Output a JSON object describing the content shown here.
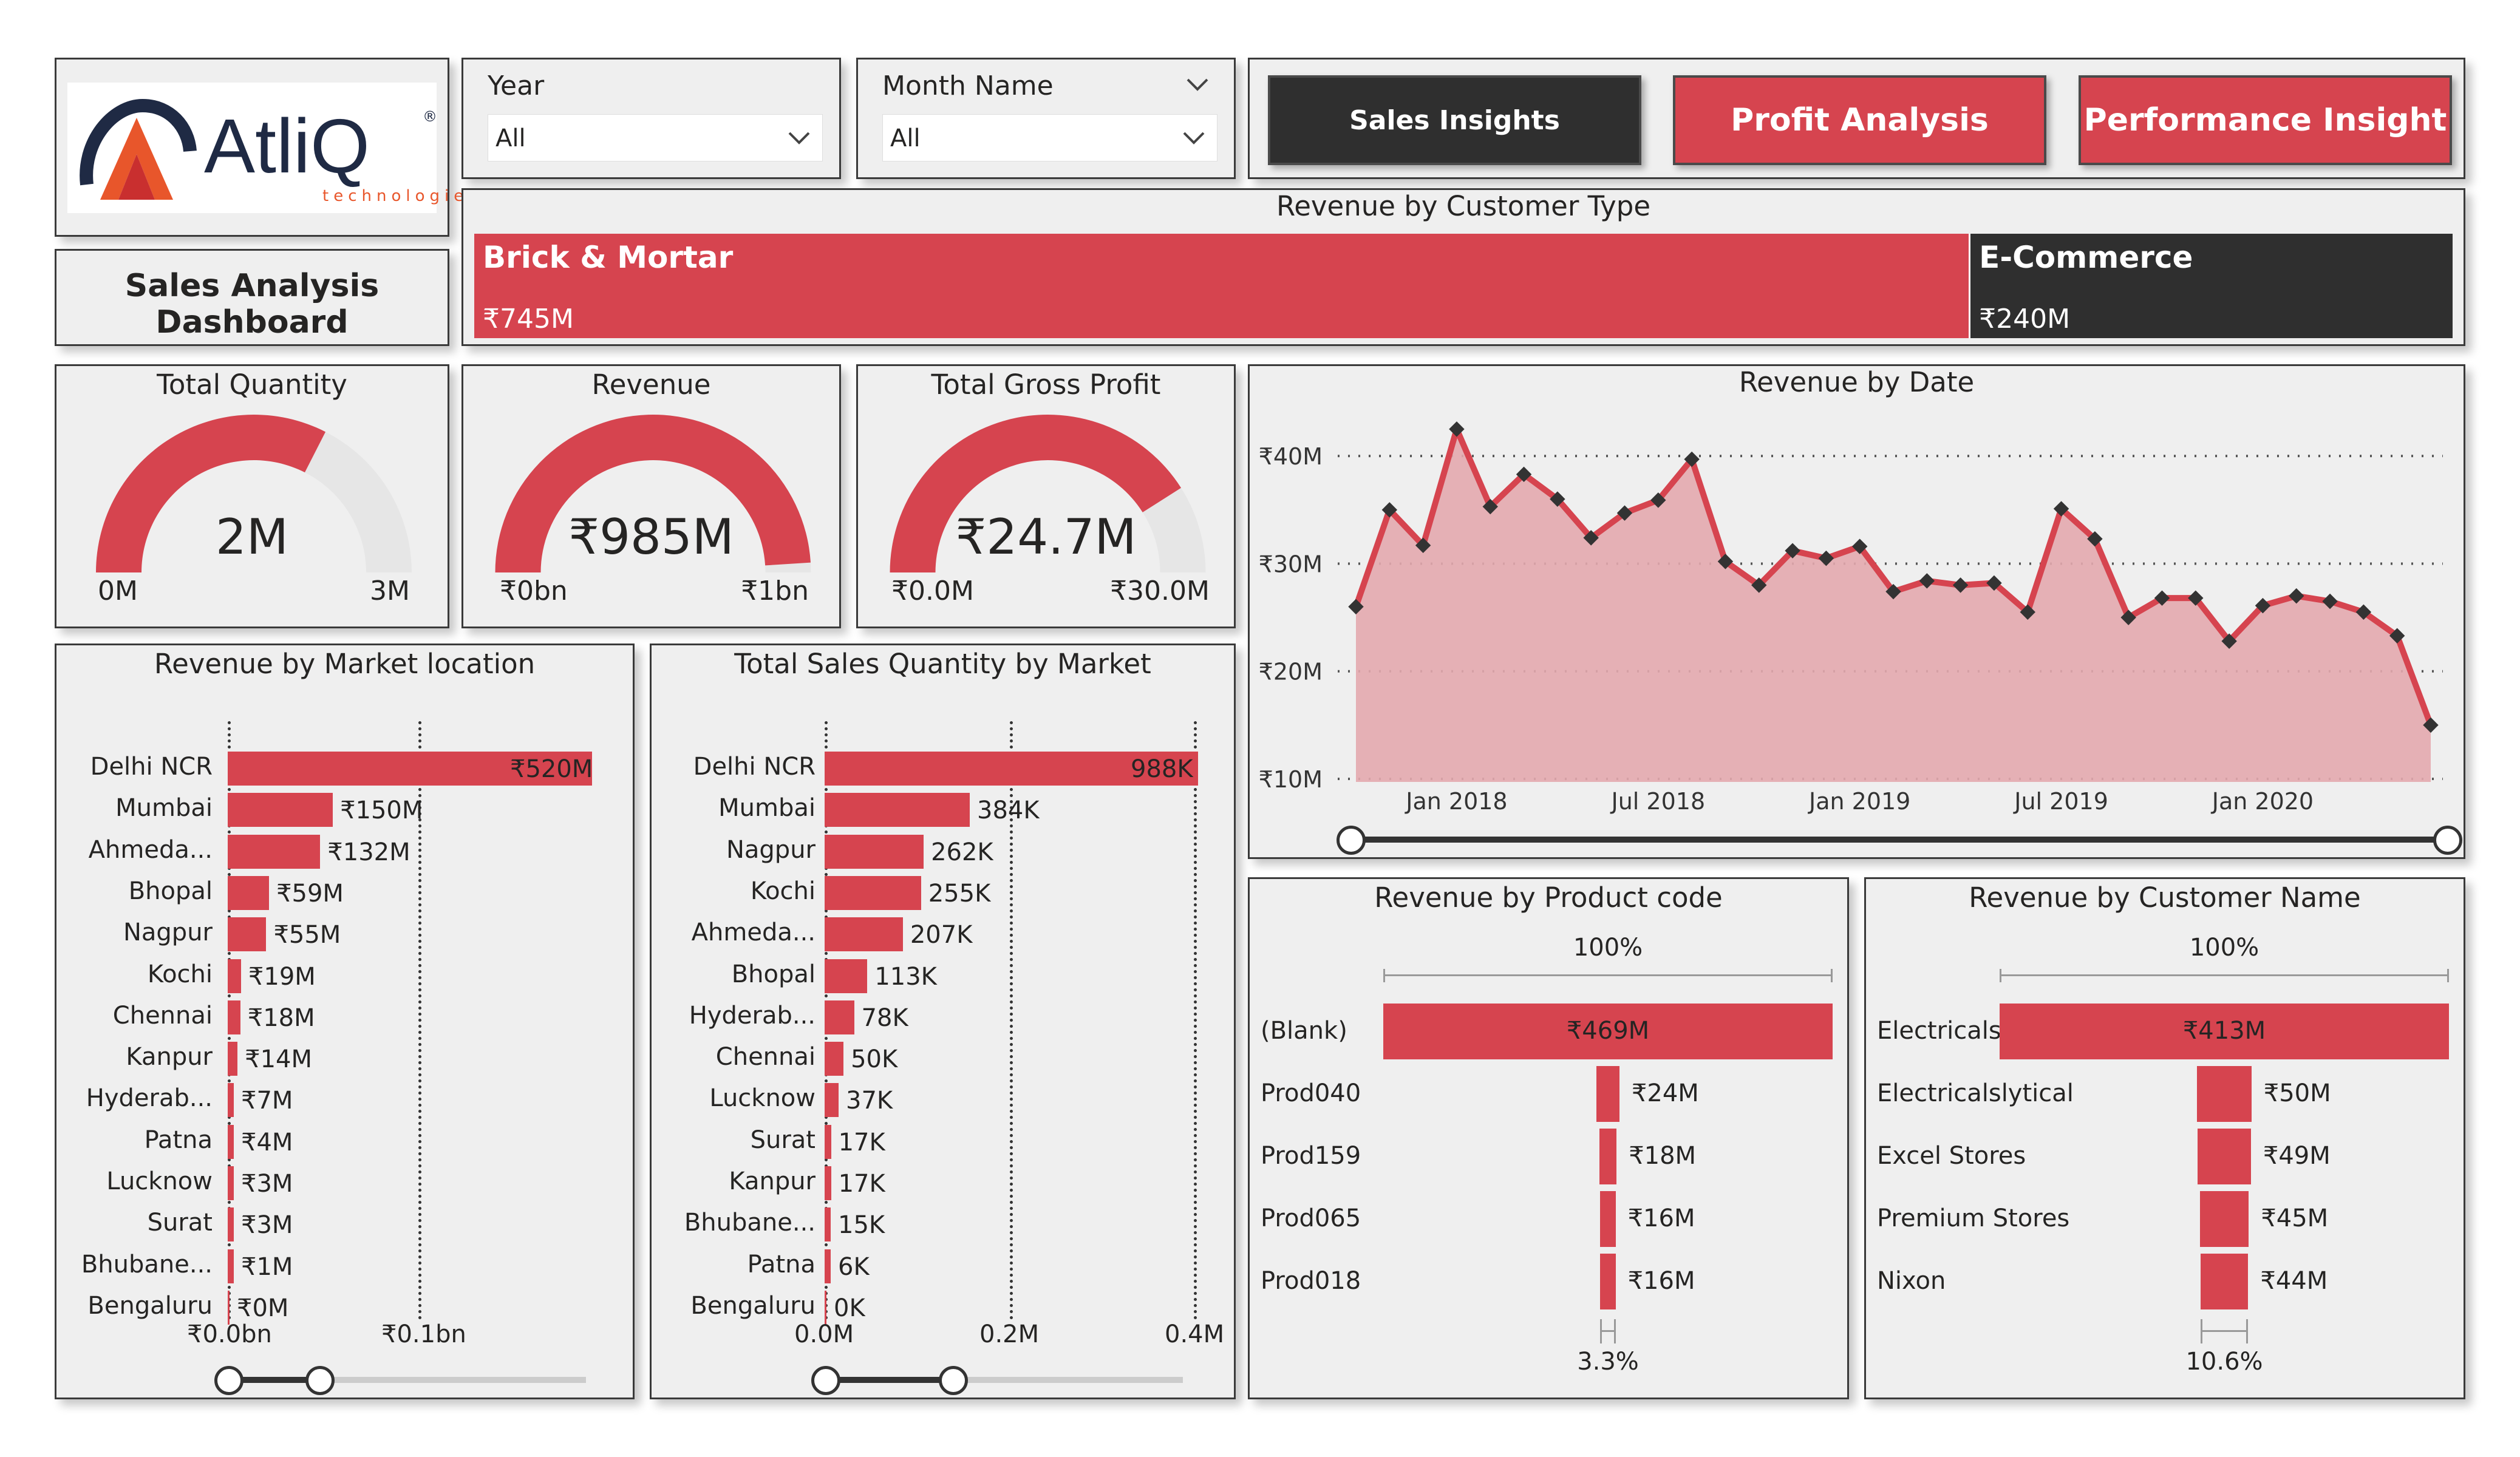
{
  "logo": {
    "brand": "AtliQ",
    "registered": "®",
    "tagline": "technologies"
  },
  "dashboard_title": "Sales Analysis Dashboard",
  "filters": {
    "year": {
      "label": "Year",
      "value": "All"
    },
    "month": {
      "label": "Month Name",
      "value": "All"
    }
  },
  "nav": {
    "sales": "Sales Insights",
    "profit": "Profit Analysis",
    "performance": "Performance Insight"
  },
  "colors": {
    "accent": "#d6444f",
    "dark": "#2f2f2f",
    "panel": "#efefef",
    "area": "#e3a9ae"
  },
  "customer_type": {
    "title": "Revenue by Customer Type",
    "segments": [
      {
        "name": "Brick & Mortar",
        "value": "₹745M",
        "amount": 745
      },
      {
        "name": "E-Commerce",
        "value": "₹240M",
        "amount": 240
      }
    ]
  },
  "gauges": [
    {
      "title": "Total Quantity",
      "value": "2M",
      "min": "0M",
      "max": "3M",
      "fraction": 0.65
    },
    {
      "title": "Revenue",
      "value": "₹985M",
      "min": "₹0bn",
      "max": "₹1bn",
      "fraction": 0.98
    },
    {
      "title": "Total Gross Profit",
      "value": "₹24.7M",
      "min": "₹0.0M",
      "max": "₹30.0M",
      "fraction": 0.82
    }
  ],
  "market_revenue": {
    "title": "Revenue by Market location",
    "rows": [
      {
        "name": "Delhi NCR",
        "label": "₹520M"
      },
      {
        "name": "Mumbai",
        "label": "₹150M"
      },
      {
        "name": "Ahmeda...",
        "label": "₹132M"
      },
      {
        "name": "Bhopal",
        "label": "₹59M"
      },
      {
        "name": "Nagpur",
        "label": "₹55M"
      },
      {
        "name": "Kochi",
        "label": "₹19M"
      },
      {
        "name": "Chennai",
        "label": "₹18M"
      },
      {
        "name": "Kanpur",
        "label": "₹14M"
      },
      {
        "name": "Hyderab...",
        "label": "₹7M"
      },
      {
        "name": "Patna",
        "label": "₹4M"
      },
      {
        "name": "Lucknow",
        "label": "₹3M"
      },
      {
        "name": "Surat",
        "label": "₹3M"
      },
      {
        "name": "Bhubane...",
        "label": "₹1M"
      },
      {
        "name": "Bengaluru",
        "label": "₹0M"
      }
    ],
    "ticks": [
      "₹0.0bn",
      "₹0.1bn"
    ]
  },
  "market_quantity": {
    "title": "Total Sales Quantity by Market",
    "rows": [
      {
        "name": "Delhi NCR",
        "label": "988K"
      },
      {
        "name": "Mumbai",
        "label": "384K"
      },
      {
        "name": "Nagpur",
        "label": "262K"
      },
      {
        "name": "Kochi",
        "label": "255K"
      },
      {
        "name": "Ahmeda...",
        "label": "207K"
      },
      {
        "name": "Bhopal",
        "label": "113K"
      },
      {
        "name": "Hyderab...",
        "label": "78K"
      },
      {
        "name": "Chennai",
        "label": "50K"
      },
      {
        "name": "Lucknow",
        "label": "37K"
      },
      {
        "name": "Surat",
        "label": "17K"
      },
      {
        "name": "Kanpur",
        "label": "17K"
      },
      {
        "name": "Bhubane...",
        "label": "15K"
      },
      {
        "name": "Patna",
        "label": "6K"
      },
      {
        "name": "Bengaluru",
        "label": "0K"
      }
    ],
    "ticks": [
      "0.0M",
      "0.2M",
      "0.4M"
    ]
  },
  "chart_data": {
    "type": "area",
    "title": "Revenue by Date",
    "y_ticks": [
      "₹10M",
      "₹20M",
      "₹30M",
      "₹40M"
    ],
    "x_ticks": [
      "Jan 2018",
      "Jul 2018",
      "Jan 2019",
      "Jul 2019",
      "Jan 2020"
    ],
    "ylim": [
      10,
      43
    ],
    "series": [
      {
        "values": [
          26.0,
          35.0,
          31.7,
          42.5,
          35.3,
          38.3,
          36.0,
          32.4,
          34.7,
          35.9,
          39.7,
          30.2,
          28.0,
          31.2,
          30.5,
          31.6,
          27.4,
          28.4,
          28.0,
          28.2,
          25.5,
          35.1,
          32.3,
          25.0,
          26.8,
          26.8,
          22.8,
          26.1,
          27.0,
          26.5,
          25.5,
          23.3,
          15.0
        ]
      }
    ]
  },
  "product_revenue": {
    "title": "Revenue by Product code",
    "top_percent": "100%",
    "bottom_percent": "3.3%",
    "rows": [
      {
        "name": "(Blank)",
        "label": "₹469M",
        "amount": 469
      },
      {
        "name": "Prod040",
        "label": "₹24M",
        "amount": 24
      },
      {
        "name": "Prod159",
        "label": "₹18M",
        "amount": 18
      },
      {
        "name": "Prod065",
        "label": "₹16M",
        "amount": 16
      },
      {
        "name": "Prod018",
        "label": "₹16M",
        "amount": 16
      }
    ]
  },
  "customer_revenue": {
    "title": "Revenue by Customer Name",
    "top_percent": "100%",
    "bottom_percent": "10.6%",
    "rows": [
      {
        "name": "Electricalsara S...",
        "label": "₹413M",
        "amount": 413
      },
      {
        "name": "Electricalslytical",
        "label": "₹50M",
        "amount": 50
      },
      {
        "name": "Excel Stores",
        "label": "₹49M",
        "amount": 49
      },
      {
        "name": "Premium Stores",
        "label": "₹45M",
        "amount": 45
      },
      {
        "name": "Nixon",
        "label": "₹44M",
        "amount": 44
      }
    ]
  }
}
